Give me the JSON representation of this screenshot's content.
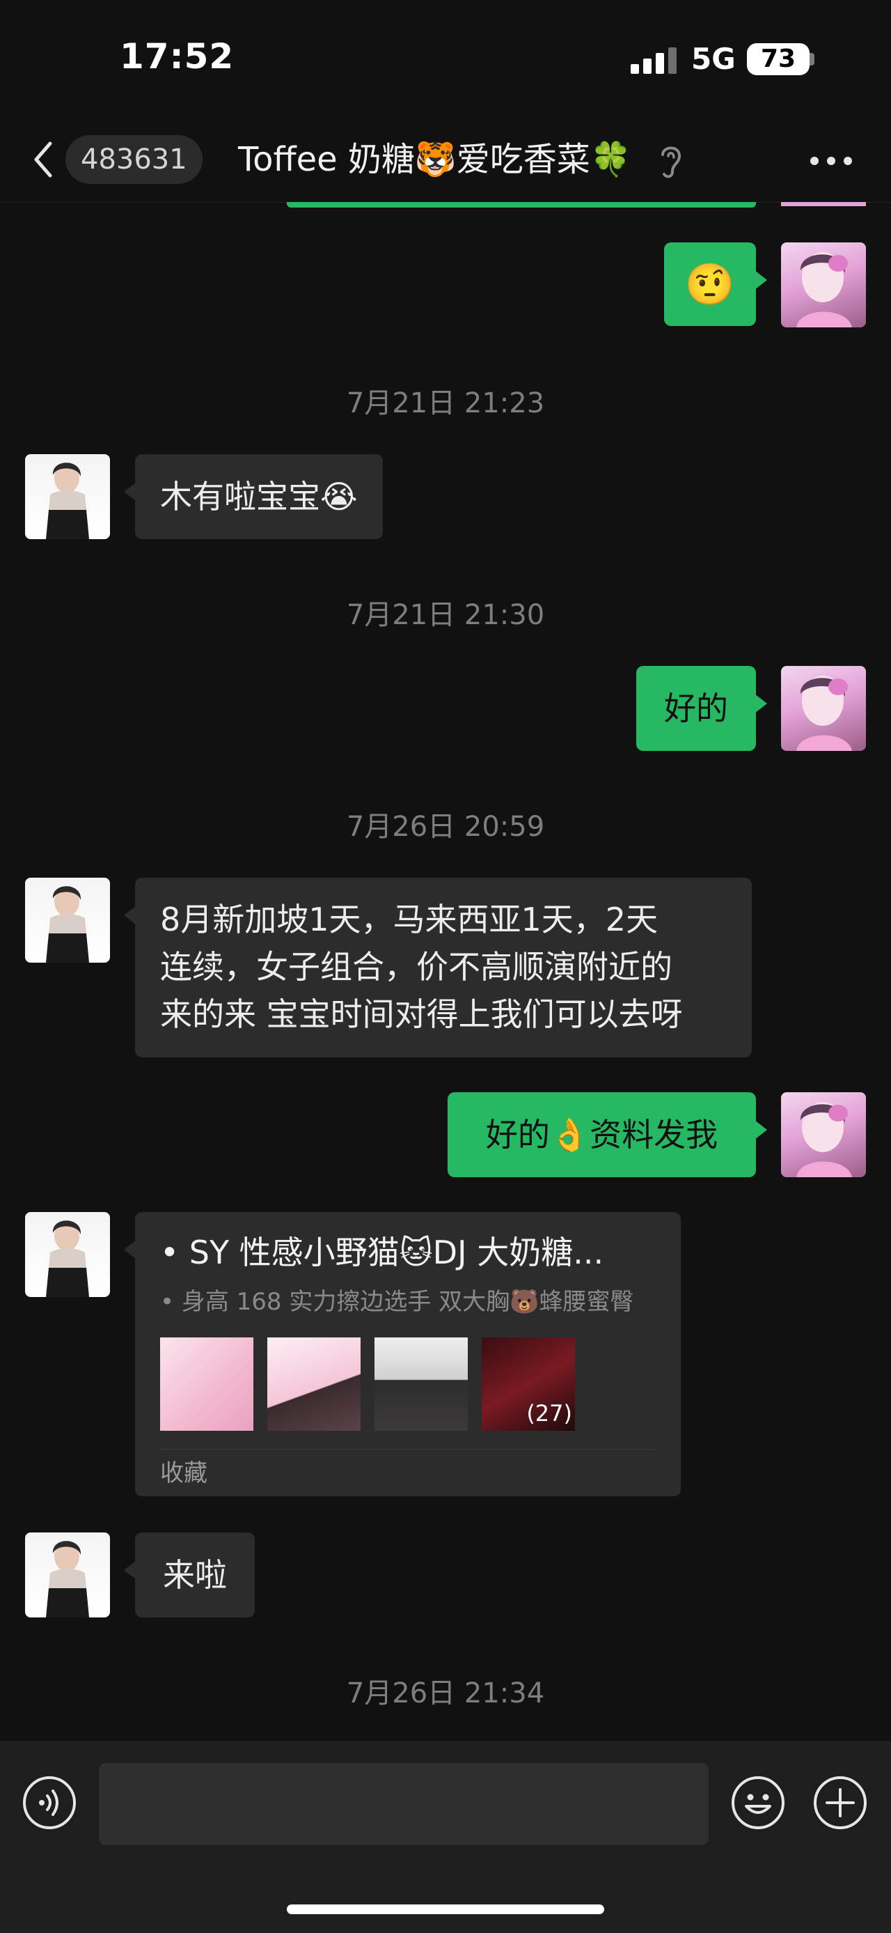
{
  "status_bar": {
    "time": "17:52",
    "network": "5G",
    "battery": "73"
  },
  "nav": {
    "unread_count": "483631",
    "title": "Toffee 奶糖🐯爱吃香菜🍀"
  },
  "messages": {
    "m1_emoji": "🤨",
    "ts1": "7月21日 21:23",
    "m2": "木有啦宝宝😭",
    "ts2": "7月21日 21:30",
    "m3": "好的",
    "ts3": "7月26日 20:59",
    "m4_lines": [
      "8月新加坡1天，马来西亚1天，2天",
      "连续，女子组合，价不高顺演附近的",
      "来的来 宝宝时间对得上我们可以去呀"
    ],
    "m5": "好的👌资料发我",
    "card": {
      "title": "• SY 性感小野猫🐱DJ 大奶糖...",
      "subtitle": "• 身高 168 实力擦边选手 双大胸🐻蜂腰蜜臀",
      "more_count": "(27)",
      "source": "收藏"
    },
    "m6": "来啦",
    "ts4": "7月26日 21:34"
  },
  "input": {
    "placeholder": ""
  },
  "icons": {
    "back": "chevron-left-icon",
    "mute": "ear-icon",
    "more": "ellipsis-icon",
    "voice": "voice-icon",
    "emoji": "smiley-icon",
    "plus": "plus-icon"
  },
  "colors": {
    "background": "#111111",
    "sent_bubble": "#27b864",
    "received_bubble": "#2c2c2c",
    "timestamp": "#7e7e7e"
  }
}
